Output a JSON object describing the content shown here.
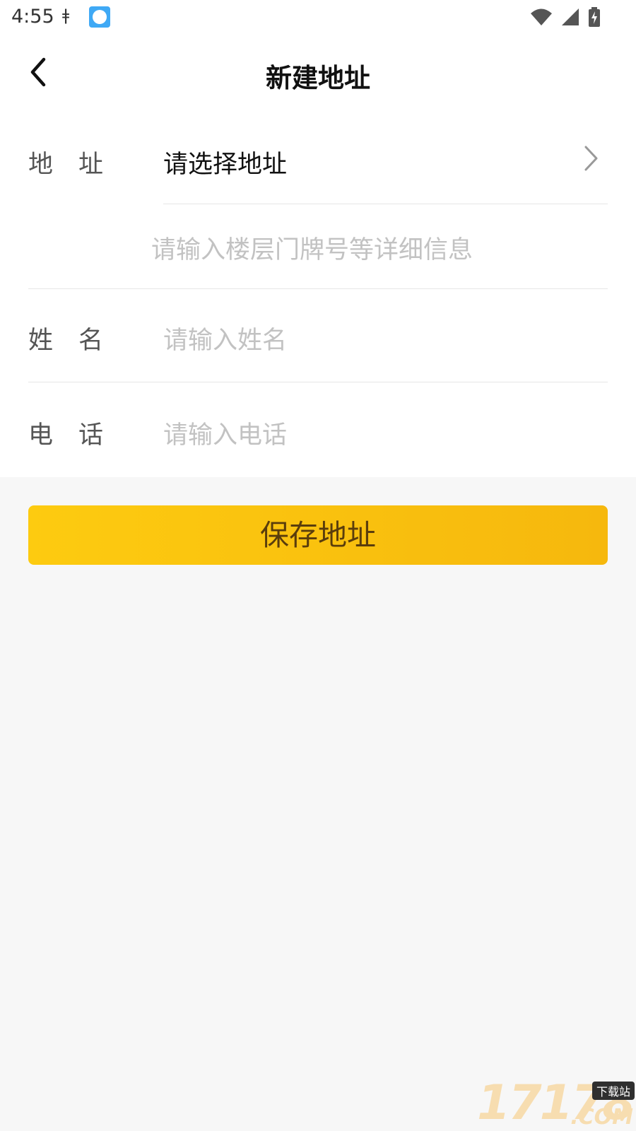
{
  "status_bar": {
    "time": "4:55",
    "glyph": "ǂ",
    "icons": [
      "app-notification-icon",
      "wifi-icon",
      "signal-icon",
      "battery-charging-icon"
    ]
  },
  "header": {
    "title": "新建地址",
    "back_icon": "back-arrow-icon"
  },
  "form": {
    "address": {
      "label": "地址",
      "value": "请选择地址",
      "arrow_icon": "chevron-right-icon"
    },
    "detail": {
      "placeholder": "请输入楼层门牌号等详细信息"
    },
    "name": {
      "label": "姓名",
      "placeholder": "请输入姓名"
    },
    "phone": {
      "label": "电话",
      "placeholder": "请输入电话"
    }
  },
  "actions": {
    "save_label": "保存地址"
  },
  "watermark": {
    "number": "17178",
    "badge": "下载站",
    "suffix": ".COM"
  },
  "colors": {
    "accent_start": "#fdcb10",
    "accent_end": "#f6b80d",
    "button_text": "#5a3d0c",
    "placeholder": "#c2c2c2",
    "background": "#f7f7f7"
  }
}
